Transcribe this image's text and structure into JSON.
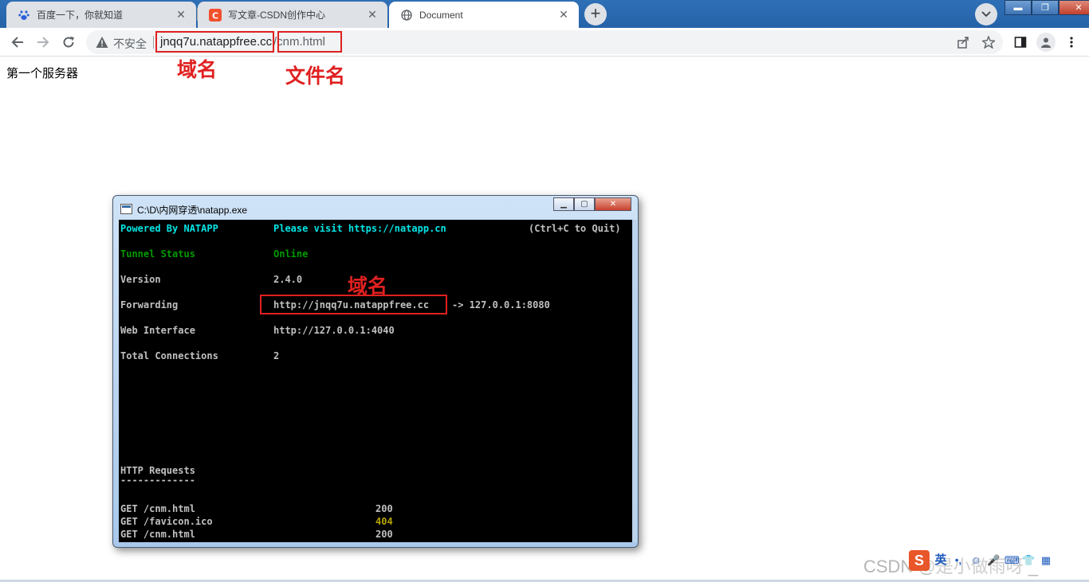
{
  "browser": {
    "tabs": [
      {
        "title": "百度一下，你就知道",
        "favicon": "baidu-paw-icon",
        "active": false
      },
      {
        "title": "写文章-CSDN创作中心",
        "favicon": "csdn-c-icon",
        "active": false
      },
      {
        "title": "Document",
        "favicon": "globe-icon",
        "active": true
      }
    ],
    "new_tab": "+",
    "address": {
      "security_label": "不安全",
      "host": "jnqq7u.natappfree.cc",
      "path": "/cnm.html"
    }
  },
  "page": {
    "body_text": "第一个服务器"
  },
  "annotations": {
    "domain_label": "域名",
    "filename_label": "文件名",
    "console_domain_label": "域名",
    "color": "#e02020"
  },
  "console": {
    "title": "C:\\D\\内网穿透\\natapp.exe",
    "header_left": "Powered By NATAPP",
    "header_mid": "Please visit https://natapp.cn",
    "header_right": "(Ctrl+C to Quit)",
    "rows": [
      {
        "label": "Tunnel Status",
        "value": "Online"
      },
      {
        "label": "Version",
        "value": "2.4.0"
      },
      {
        "label": "Forwarding",
        "value": "http://jnqq7u.natappfree.cc",
        "target": "-> 127.0.0.1:8080"
      },
      {
        "label": "Web Interface",
        "value": "http://127.0.0.1:4040"
      },
      {
        "label": "Total Connections",
        "value": "2"
      }
    ],
    "requests_title": "HTTP Requests",
    "requests_rule": "-------------",
    "requests": [
      {
        "method_path": "GET /cnm.html",
        "status": "200"
      },
      {
        "method_path": "GET /favicon.ico",
        "status": "404"
      },
      {
        "method_path": "GET /cnm.html",
        "status": "200"
      }
    ],
    "colors": {
      "cyan": "#00e5e5",
      "green": "#009a00",
      "warn": "#b5a500"
    }
  },
  "watermark": {
    "text": "CSDN @是小做雨呀 _",
    "ime_logo": "S",
    "ime_lang": "英"
  }
}
